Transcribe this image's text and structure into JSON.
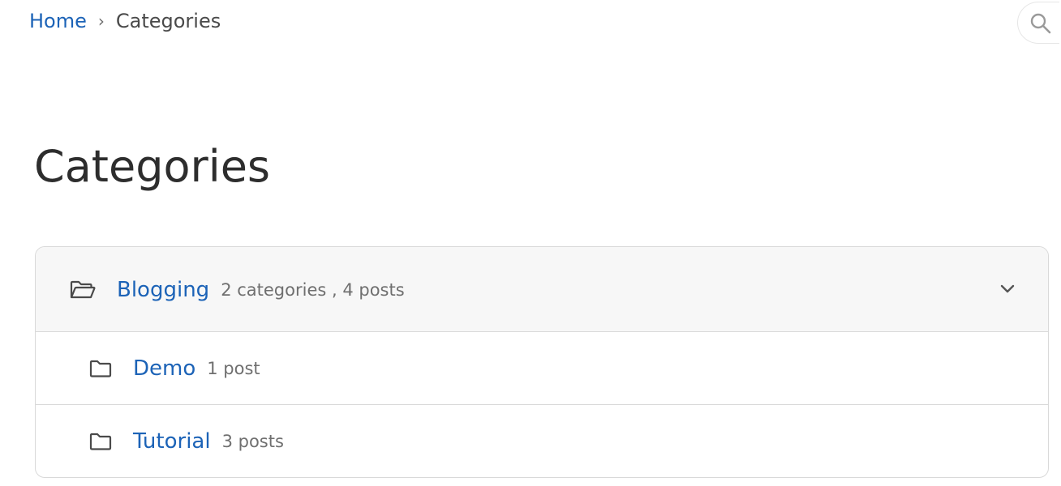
{
  "breadcrumb": {
    "home_label": "Home",
    "separator": "›",
    "current_label": "Categories"
  },
  "search": {
    "icon": "search-icon"
  },
  "page": {
    "title": "Categories"
  },
  "categories": {
    "parent": {
      "icon": "folder-open-icon",
      "name": "Blogging",
      "meta": "2 categories , 4 posts",
      "toggle_icon": "chevron-down-icon"
    },
    "children": [
      {
        "icon": "folder-icon",
        "name": "Demo",
        "meta": "1 post"
      },
      {
        "icon": "folder-icon",
        "name": "Tutorial",
        "meta": "3 posts"
      }
    ]
  },
  "colors": {
    "link": "#1c63b7",
    "text": "#2d2d2d",
    "muted": "#6f6f6f",
    "border": "#d9d9d9",
    "header_bg": "#f7f7f7"
  }
}
